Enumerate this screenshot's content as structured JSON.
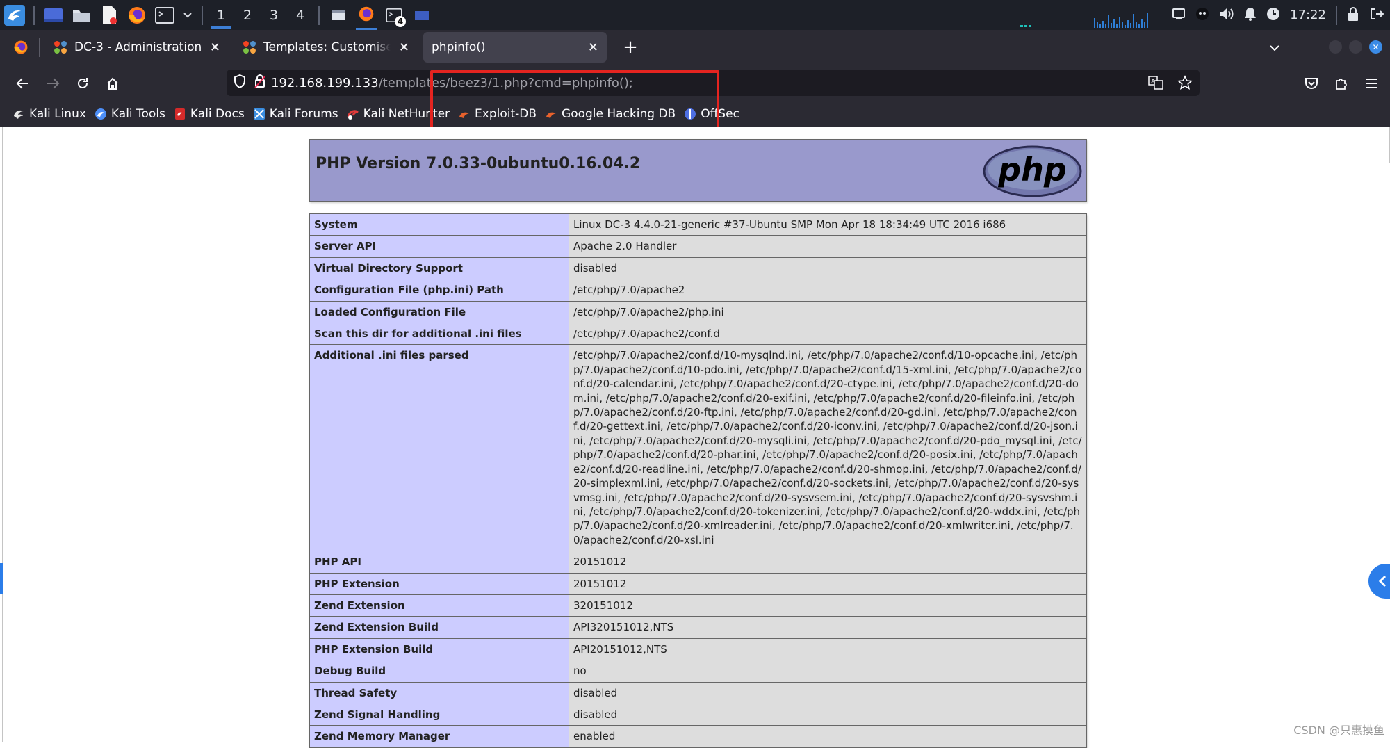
{
  "taskbar": {
    "workspaces": [
      "1",
      "2",
      "3",
      "4"
    ],
    "active_workspace": "1",
    "terminal_badge": "4",
    "clock": "17:22"
  },
  "browser": {
    "tabs": [
      {
        "title": "DC-3 - Administration",
        "active": false
      },
      {
        "title": "Templates: Customise (Be",
        "active": false
      },
      {
        "title": "phpinfo()",
        "active": true
      }
    ],
    "url": {
      "host": "192.168.199.133",
      "path": "/templates/beez3/1.php?cmd=phpinfo();"
    },
    "bookmarks": [
      {
        "label": "Kali Linux",
        "icon": "kali-dragon-icon",
        "color": "#e8e8e8"
      },
      {
        "label": "Kali Tools",
        "icon": "kali-tools-icon",
        "color": "#4d8ef7"
      },
      {
        "label": "Kali Docs",
        "icon": "kali-docs-icon",
        "color": "#d42a2a"
      },
      {
        "label": "Kali Forums",
        "icon": "kali-forums-icon",
        "color": "#3a8de0"
      },
      {
        "label": "Kali NetHunter",
        "icon": "nethunter-icon",
        "color": "#e23b3b"
      },
      {
        "label": "Exploit-DB",
        "icon": "exploit-db-icon",
        "color": "#e8612c"
      },
      {
        "label": "Google Hacking DB",
        "icon": "ghdb-icon",
        "color": "#e8612c"
      },
      {
        "label": "OffSec",
        "icon": "offsec-icon",
        "color": "#4e6fe3"
      }
    ]
  },
  "phpinfo": {
    "title": "PHP Version 7.0.33-0ubuntu0.16.04.2",
    "logo_text": "php",
    "rows": [
      {
        "key": "System",
        "value": "Linux DC-3 4.4.0-21-generic #37-Ubuntu SMP Mon Apr 18 18:34:49 UTC 2016 i686"
      },
      {
        "key": "Server API",
        "value": "Apache 2.0 Handler"
      },
      {
        "key": "Virtual Directory Support",
        "value": "disabled"
      },
      {
        "key": "Configuration File (php.ini) Path",
        "value": "/etc/php/7.0/apache2"
      },
      {
        "key": "Loaded Configuration File",
        "value": "/etc/php/7.0/apache2/php.ini"
      },
      {
        "key": "Scan this dir for additional .ini files",
        "value": "/etc/php/7.0/apache2/conf.d"
      },
      {
        "key": "Additional .ini files parsed",
        "value": "/etc/php/7.0/apache2/conf.d/10-mysqlnd.ini, /etc/php/7.0/apache2/conf.d/10-opcache.ini, /etc/php/7.0/apache2/conf.d/10-pdo.ini, /etc/php/7.0/apache2/conf.d/15-xml.ini, /etc/php/7.0/apache2/conf.d/20-calendar.ini, /etc/php/7.0/apache2/conf.d/20-ctype.ini, /etc/php/7.0/apache2/conf.d/20-dom.ini, /etc/php/7.0/apache2/conf.d/20-exif.ini, /etc/php/7.0/apache2/conf.d/20-fileinfo.ini, /etc/php/7.0/apache2/conf.d/20-ftp.ini, /etc/php/7.0/apache2/conf.d/20-gd.ini, /etc/php/7.0/apache2/conf.d/20-gettext.ini, /etc/php/7.0/apache2/conf.d/20-iconv.ini, /etc/php/7.0/apache2/conf.d/20-json.ini, /etc/php/7.0/apache2/conf.d/20-mysqli.ini, /etc/php/7.0/apache2/conf.d/20-pdo_mysql.ini, /etc/php/7.0/apache2/conf.d/20-phar.ini, /etc/php/7.0/apache2/conf.d/20-posix.ini, /etc/php/7.0/apache2/conf.d/20-readline.ini, /etc/php/7.0/apache2/conf.d/20-shmop.ini, /etc/php/7.0/apache2/conf.d/20-simplexml.ini, /etc/php/7.0/apache2/conf.d/20-sockets.ini, /etc/php/7.0/apache2/conf.d/20-sysvmsg.ini, /etc/php/7.0/apache2/conf.d/20-sysvsem.ini, /etc/php/7.0/apache2/conf.d/20-sysvshm.ini, /etc/php/7.0/apache2/conf.d/20-tokenizer.ini, /etc/php/7.0/apache2/conf.d/20-wddx.ini, /etc/php/7.0/apache2/conf.d/20-xmlreader.ini, /etc/php/7.0/apache2/conf.d/20-xmlwriter.ini, /etc/php/7.0/apache2/conf.d/20-xsl.ini"
      },
      {
        "key": "PHP API",
        "value": "20151012"
      },
      {
        "key": "PHP Extension",
        "value": "20151012"
      },
      {
        "key": "Zend Extension",
        "value": "320151012"
      },
      {
        "key": "Zend Extension Build",
        "value": "API320151012,NTS"
      },
      {
        "key": "PHP Extension Build",
        "value": "API20151012,NTS"
      },
      {
        "key": "Debug Build",
        "value": "no"
      },
      {
        "key": "Thread Safety",
        "value": "disabled"
      },
      {
        "key": "Zend Signal Handling",
        "value": "disabled"
      },
      {
        "key": "Zend Memory Manager",
        "value": "enabled"
      }
    ]
  },
  "watermark": "CSDN @只惠摸鱼",
  "colors": {
    "highlight_box": "#e52420",
    "php_header": "#9999cc",
    "key_cell": "#ccccff",
    "value_cell": "#dddddd",
    "browser_chrome": "#2b2a33",
    "taskbar": "#1d2028"
  }
}
